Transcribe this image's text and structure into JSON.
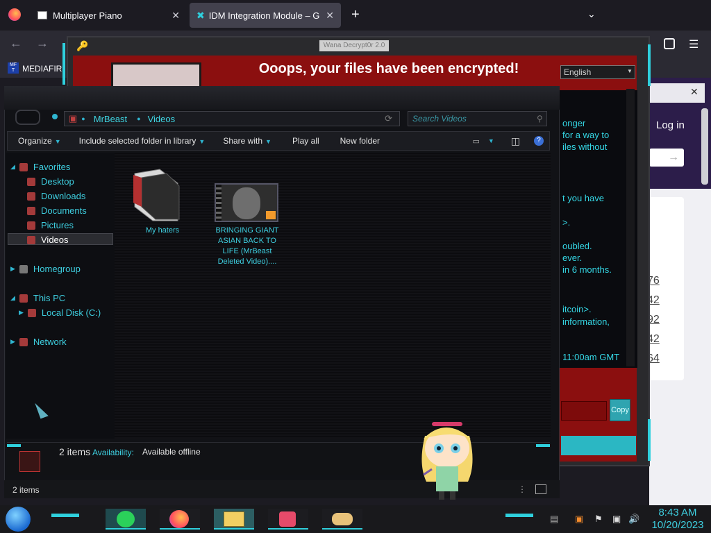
{
  "browser": {
    "tabs": [
      {
        "title": "Multiplayer Piano"
      },
      {
        "title": "IDM Integration Module – Get t"
      }
    ],
    "new_tab": "+",
    "bookmark": "MEDIAFIR",
    "site_login": "Log in",
    "site_numbers": [
      "76",
      "42",
      "92",
      "42",
      "64"
    ]
  },
  "wanna": {
    "title": "Wana Decrypt0r 2.0",
    "headline": "Ooops, your files have been encrypted!",
    "language": "English",
    "text_lines": [
      "onger",
      "for a way to",
      "iles without",
      "t you have",
      ">.",
      "oubled.",
      "ever.",
      "in 6 months.",
      "itcoin>.",
      " information,",
      "11:00am GMT"
    ],
    "copy_label": "Copy"
  },
  "explorer": {
    "breadcrumb": [
      "MrBeast",
      "Videos"
    ],
    "search_placeholder": "Search Videos",
    "toolbar": {
      "organize": "Organize",
      "include": "Include selected folder in library",
      "share": "Share with",
      "play_all": "Play all",
      "new_folder": "New folder"
    },
    "nav": {
      "favorites": "Favorites",
      "desktop": "Desktop",
      "downloads": "Downloads",
      "documents": "Documents",
      "pictures": "Pictures",
      "videos": "Videos",
      "homegroup": "Homegroup",
      "this_pc": "This PC",
      "local_disk": "Local Disk (C:)",
      "network": "Network"
    },
    "items": [
      {
        "name": "My haters"
      },
      {
        "name_lines": [
          "BRINGING GIANT",
          "ASIAN BACK TO",
          "LIFE (MrBeast",
          "Deleted Video)...."
        ]
      }
    ],
    "details": {
      "count": "2 items",
      "availability_label": "Availability:",
      "availability_value": "Available offline"
    },
    "status": "2 items"
  },
  "taskbar": {
    "time": "8:43 AM",
    "date": "10/20/2023"
  },
  "colors": {
    "accent_cyan": "#3ecfe0",
    "ransom_red": "#8b0f0f"
  }
}
